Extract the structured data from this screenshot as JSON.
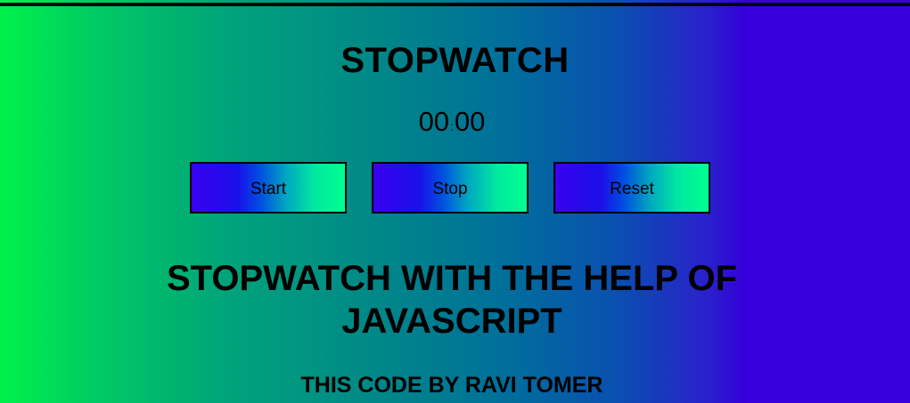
{
  "title": "STOPWATCH",
  "timer": {
    "minutes": "00",
    "separator": ":",
    "seconds": "00"
  },
  "buttons": {
    "start": "Start",
    "stop": "Stop",
    "reset": "Reset"
  },
  "heading": {
    "line1": "STOPWATCH WITH THE HELP OF",
    "line2": "JAVASCRIPT"
  },
  "credit": "THIS CODE BY RAVI TOMER",
  "colors": {
    "gradient_left": "#00f24a",
    "gradient_right": "#3500da",
    "button_left": "#3a00f0",
    "button_right": "#00ff90",
    "text": "#000000"
  }
}
